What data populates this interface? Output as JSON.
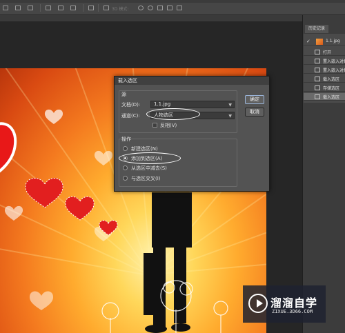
{
  "optionsbar": {
    "mode_3d_label": "3D 模式:"
  },
  "history_panel": {
    "tab_label": "历史记录",
    "snapshot": "1.1.jpg",
    "items": [
      "打开",
      "置入嵌入对象",
      "置入嵌入对象",
      "载入选区",
      "存储选区",
      "载入选区"
    ]
  },
  "dialog": {
    "title": "载入选区",
    "source_group": "源",
    "document_label": "文档(D):",
    "document_value": "1.1.jpg",
    "channel_label": "通道(C):",
    "channel_value": "人物选区",
    "invert_label": "反相(V)",
    "operation_group": "操作",
    "operations": [
      "新建选区(N)",
      "添加到选区(A)",
      "从选区中减去(S)",
      "与选区交叉(I)"
    ],
    "ok_label": "确定",
    "cancel_label": "取消"
  },
  "watermark": {
    "brand": "溜溜自学",
    "url": "ZIXUE.3D66.COM"
  }
}
